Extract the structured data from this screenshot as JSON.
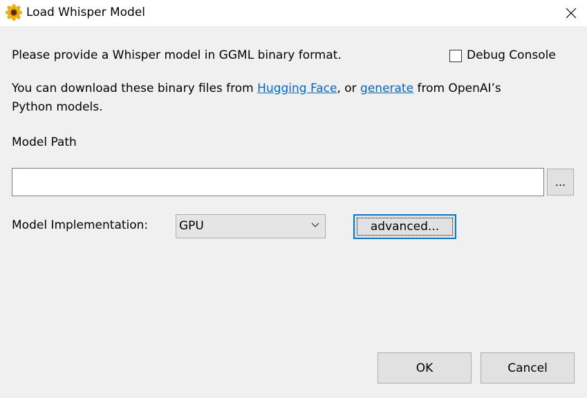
{
  "window": {
    "title": "Load Whisper Model",
    "app_icon": "sunflower-icon",
    "close_icon": "close-icon"
  },
  "intro": {
    "line1": "Please provide a Whisper model in GGML binary format.",
    "line2_prefix": "You can download these binary files from ",
    "link1": "Hugging Face",
    "line2_mid": ", or ",
    "link2": "generate",
    "line2_suffix": " from OpenAI’s",
    "line3": "Python models."
  },
  "debug_console": {
    "label": "Debug Console",
    "checked": false
  },
  "model_path": {
    "label": "Model Path",
    "value": "",
    "browse_label": "..."
  },
  "implementation": {
    "label": "Model Implementation:",
    "selected": "GPU",
    "advanced_label": "advanced..."
  },
  "buttons": {
    "ok": "OK",
    "cancel": "Cancel"
  },
  "colors": {
    "link": "#0066cc",
    "focus_accent": "#0078d7",
    "dialog_bg": "#f0f0f0",
    "button_bg": "#e1e1e1"
  }
}
